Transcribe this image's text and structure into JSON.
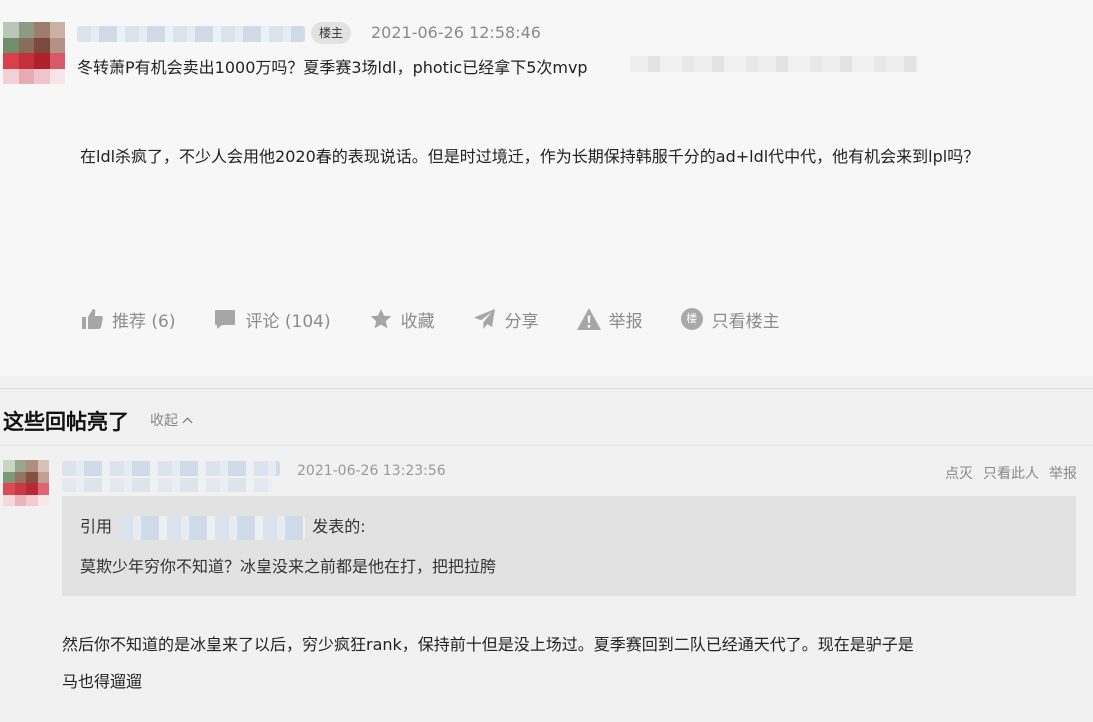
{
  "post": {
    "badge": "楼主",
    "time": "2021-06-26 12:58:46",
    "title": "冬转萧P有机会卖出1000万吗？夏季赛3场ldl，photic已经拿下5次mvp",
    "body": "在ldl杀疯了，不少人会用他2020春的表现说话。但是时过境迁，作为长期保持韩服千分的ad+ldl代中代，他有机会来到lpl吗？",
    "actions": {
      "recommend": "推荐 (6)",
      "comment": "评论 (104)",
      "favorite": "收藏",
      "share": "分享",
      "report": "举报",
      "lou_glyph": "楼",
      "only_op": "只看楼主"
    }
  },
  "highlights": {
    "title": "这些回帖亮了",
    "collapse": "收起"
  },
  "reply": {
    "time": "2021-06-26 13:23:56",
    "links": {
      "downvote": "点灭",
      "only_this": "只看此人",
      "report": "举报"
    },
    "quote": {
      "prefix": "引用",
      "suffix": "发表的:",
      "text": "莫欺少年穷你不知道？冰皇没来之前都是他在打，把把拉胯"
    },
    "body": "然后你不知道的是冰皇来了以后，穷少疯狂rank，保持前十但是没上场过。夏季赛回到二队已经通天代了。现在是驴子是马也得遛遛"
  },
  "colors": {
    "post_bg": "#f7f7f7",
    "page_bg": "#f1f1f1",
    "quote_bg": "#e2e2e2",
    "muted_text": "#8c8c8c"
  }
}
